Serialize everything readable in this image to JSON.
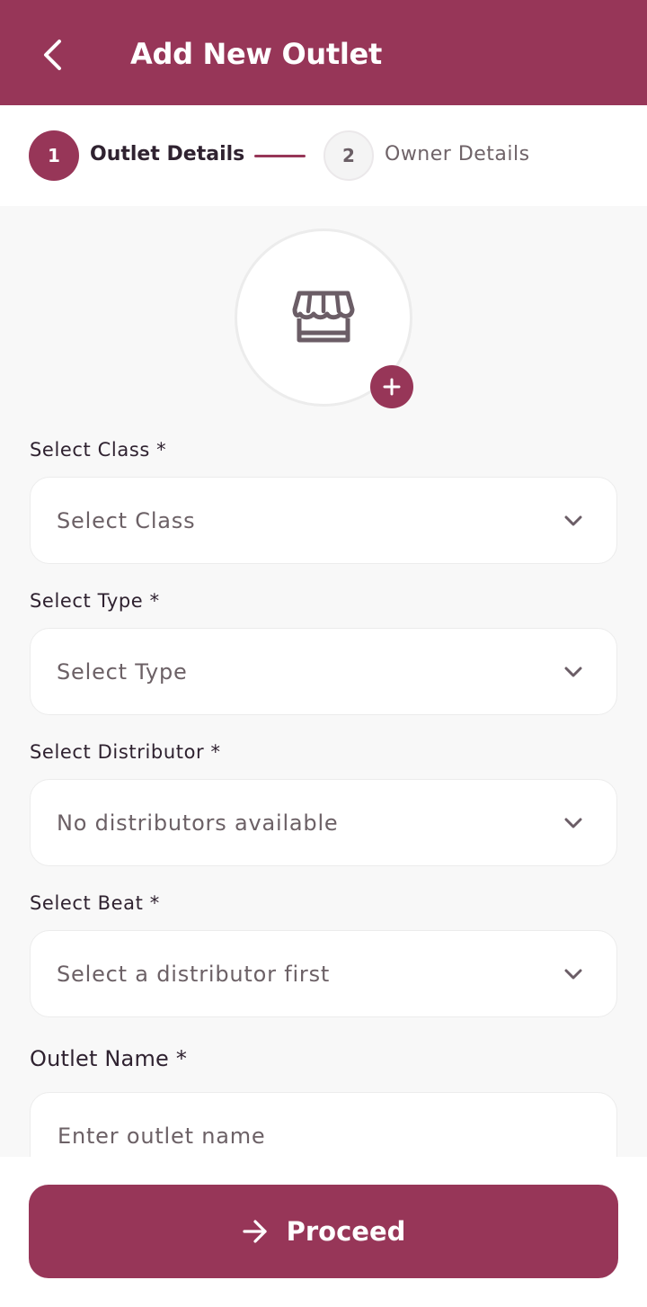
{
  "header": {
    "title": "Add New Outlet",
    "back_icon": "chevron-left-icon",
    "bg_color": "#973658"
  },
  "stepper": {
    "steps": [
      {
        "number": "1",
        "label": "Outlet Details",
        "active": true
      },
      {
        "number": "2",
        "label": "Owner Details",
        "active": false
      }
    ]
  },
  "avatar": {
    "icon": "storefront-icon",
    "add_icon": "plus-icon"
  },
  "form": {
    "class": {
      "label": "Select Class *",
      "value": "Select Class"
    },
    "type": {
      "label": "Select Type *",
      "value": "Select Type"
    },
    "distributor": {
      "label": "Select Distributor *",
      "value": "No distributors available"
    },
    "beat": {
      "label": "Select Beat *",
      "value": "Select a distributor first"
    },
    "outlet_name": {
      "label": "Outlet Name *",
      "placeholder": "Enter outlet name",
      "value": ""
    }
  },
  "footer": {
    "proceed_label": "Proceed",
    "proceed_icon": "arrow-right-icon"
  },
  "colors": {
    "accent": "#973658",
    "background": "#f8f8f8",
    "text": "#2f2230",
    "muted_text": "#6c6166"
  }
}
